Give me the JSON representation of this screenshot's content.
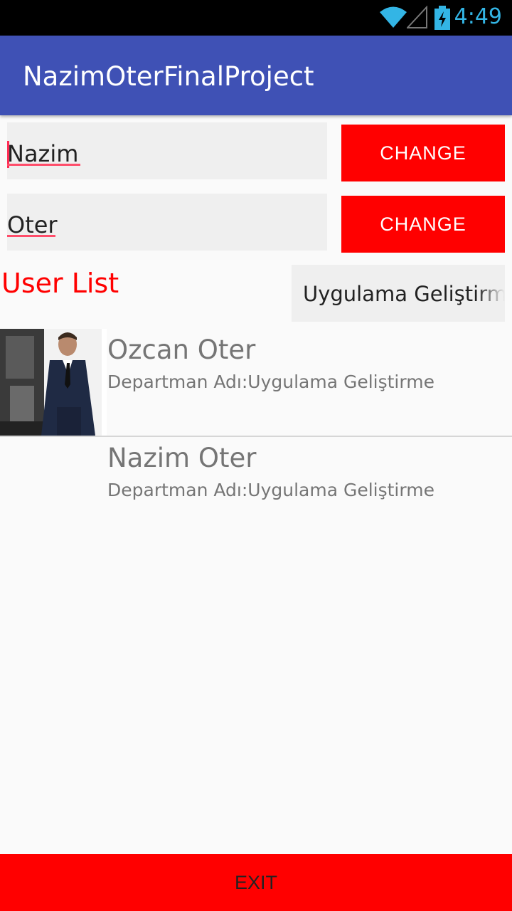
{
  "status_bar": {
    "time": "4:49",
    "icons": [
      "wifi-icon",
      "signal-icon",
      "battery-charging-icon"
    ],
    "accent_color": "#33b5e5"
  },
  "app_bar": {
    "title": "NazimOterFinalProject",
    "color": "#3f51b5"
  },
  "form": {
    "first_name": {
      "value": "Nazim",
      "button_label": "CHANGE"
    },
    "last_name": {
      "value": "Oter",
      "button_label": "CHANGE"
    },
    "button_color": "#ff0000"
  },
  "user_list": {
    "label": "User List",
    "department_spinner": {
      "selected": "Uygulama Geliştirme"
    },
    "items": [
      {
        "name": "Ozcan Oter",
        "department": "Departman Adı:Uygulama Geliştirme",
        "has_photo": true
      },
      {
        "name": "Nazim Oter",
        "department": "Departman Adı:Uygulama Geliştirme",
        "has_photo": false
      }
    ]
  },
  "footer": {
    "exit_label": "EXIT"
  }
}
